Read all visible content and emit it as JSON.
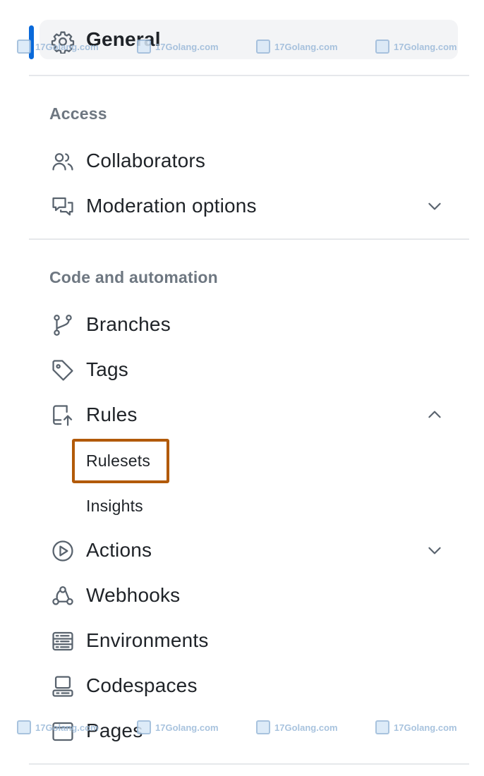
{
  "general": {
    "label": "General",
    "icon": "gear-icon"
  },
  "sections": {
    "access": {
      "heading": "Access",
      "items": [
        {
          "label": "Collaborators",
          "icon": "people-icon"
        },
        {
          "label": "Moderation options",
          "icon": "comment-discussion-icon",
          "expandable": true,
          "expanded": false
        }
      ]
    },
    "code": {
      "heading": "Code and automation",
      "items": [
        {
          "label": "Branches",
          "icon": "git-branch-icon"
        },
        {
          "label": "Tags",
          "icon": "tag-icon"
        },
        {
          "label": "Rules",
          "icon": "repo-push-icon",
          "expandable": true,
          "expanded": true
        },
        {
          "label": "Actions",
          "icon": "play-icon",
          "expandable": true,
          "expanded": false
        },
        {
          "label": "Webhooks",
          "icon": "webhook-icon"
        },
        {
          "label": "Environments",
          "icon": "server-icon"
        },
        {
          "label": "Codespaces",
          "icon": "codespaces-icon"
        },
        {
          "label": "Pages",
          "icon": "browser-icon"
        }
      ],
      "rules_subitems": [
        {
          "label": "Rulesets",
          "highlighted": true
        },
        {
          "label": "Insights"
        }
      ]
    }
  },
  "watermark": {
    "text": "17Golang.com"
  },
  "colors": {
    "accent": "#0969da",
    "highlight_border": "#b25a09",
    "muted": "#6e7781"
  }
}
